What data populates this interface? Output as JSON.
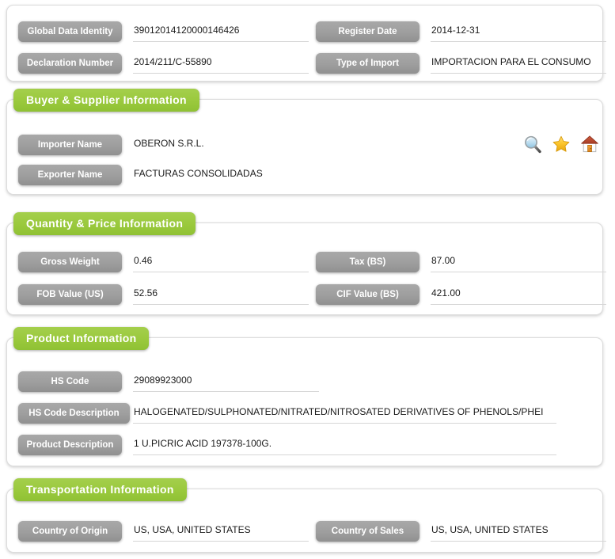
{
  "theme": {
    "accent_green": "#9ac93d",
    "label_gray": "#9e9e9e",
    "panel_border": "#dcdcdc",
    "underline": "#d6d6d6",
    "value_text": "#1a1a1a"
  },
  "sections": {
    "general": {
      "fields": [
        {
          "label": "Global Data Identity",
          "value": "39012014120000146426"
        },
        {
          "label": "Register Date",
          "value": "2014-12-31"
        },
        {
          "label": "Declaration Number",
          "value": "2014/211/C-55890"
        },
        {
          "label": "Type of Import",
          "value": "IMPORTACION PARA EL CONSUMO"
        }
      ]
    },
    "buyer_supplier": {
      "title": "Buyer & Supplier Information",
      "fields": [
        {
          "label": "Importer Name",
          "value": "OBERON S.R.L."
        },
        {
          "label": "Exporter Name",
          "value": "FACTURAS CONSOLIDADAS"
        }
      ],
      "actions": [
        {
          "icon": "magnifier-icon",
          "title": "Search"
        },
        {
          "icon": "star-icon",
          "title": "Favorite"
        },
        {
          "icon": "home-icon",
          "title": "Home"
        }
      ]
    },
    "quantity_price": {
      "title": "Quantity & Price Information",
      "fields": [
        {
          "label": "Gross Weight",
          "value": "0.46"
        },
        {
          "label": "Tax (BS)",
          "value": "87.00"
        },
        {
          "label": "FOB Value (US)",
          "value": "52.56"
        },
        {
          "label": "CIF Value (BS)",
          "value": "421.00"
        }
      ]
    },
    "product": {
      "title": "Product Information",
      "fields": [
        {
          "label": "HS Code",
          "value": "29089923000"
        },
        {
          "label": "HS Code Description",
          "value": "HALOGENATED/SULPHONATED/NITRATED/NITROSATED DERIVATIVES OF PHENOLS/PHEI"
        },
        {
          "label": "Product Description",
          "value": "1 U.PICRIC ACID 197378-100G."
        }
      ]
    },
    "transportation": {
      "title": "Transportation Information",
      "fields": [
        {
          "label": "Country of Origin",
          "value": "US, USA, UNITED STATES"
        },
        {
          "label": "Country of Sales",
          "value": "US, USA, UNITED STATES"
        }
      ]
    }
  }
}
